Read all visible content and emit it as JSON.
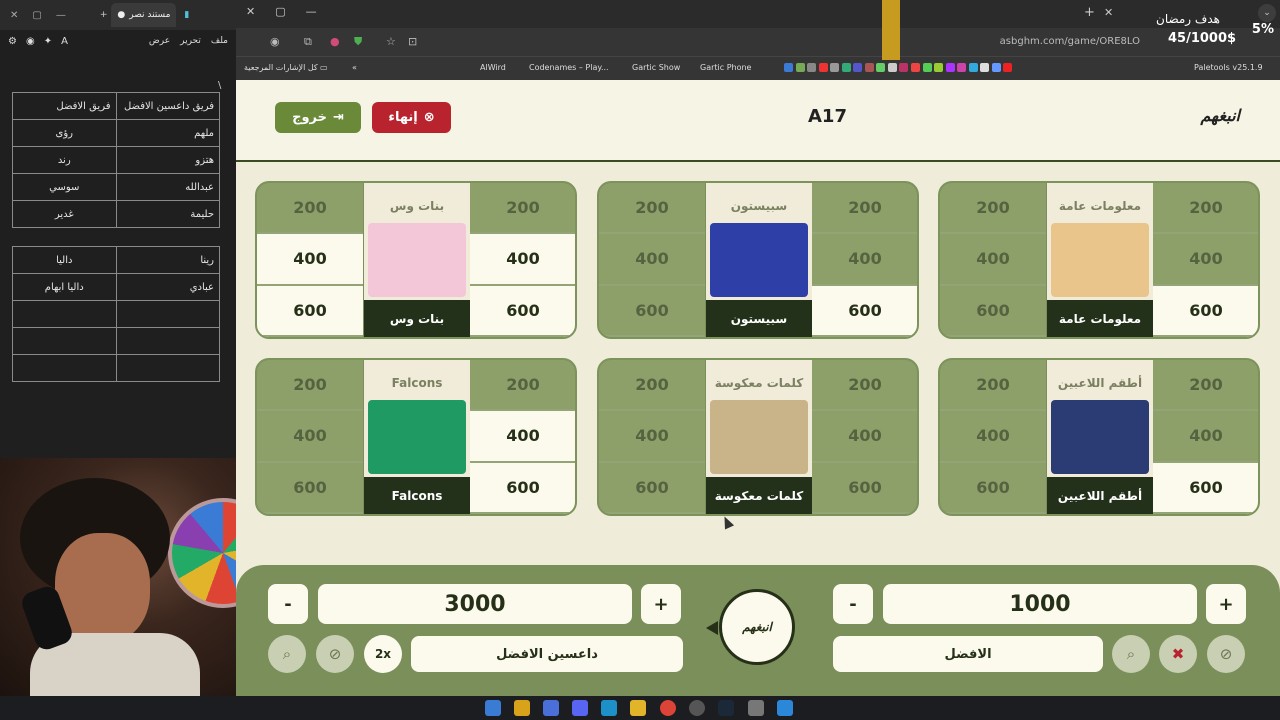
{
  "editor": {
    "tab_title": "مستند نصر",
    "menu": [
      "ملف",
      "تحرير",
      "عرض"
    ],
    "slash": "\\",
    "table1": {
      "headers": [
        "فريق داعسين الافضل",
        "فريق الافضل"
      ],
      "rows": [
        [
          "ملهم",
          "رؤى"
        ],
        [
          "هتزو",
          "رند"
        ],
        [
          "عبدالله",
          "سوسي"
        ],
        [
          "حليمة",
          "غدير"
        ]
      ]
    },
    "table2": {
      "rows": [
        [
          "رينا",
          "داليا"
        ],
        [
          "عبادي",
          "داليا ابهام"
        ],
        [
          "",
          ""
        ],
        [
          "",
          ""
        ],
        [
          "",
          ""
        ]
      ]
    }
  },
  "browser": {
    "url": "asbghm.com/game/ORE8LO",
    "bookmarks_folder": "كل الإشارات المرجعية",
    "bookmarks": [
      "AlWird",
      "Codenames – Play...",
      "Gartic Show",
      "Gartic Phone",
      "Paletools v25.1.9"
    ]
  },
  "overlay": {
    "goal_label": "هدف رمضان",
    "goal_value": "45/1000$",
    "percent": "5%"
  },
  "game": {
    "logo": "انبغهم",
    "room_code": "A17",
    "end_label": "إنهاء",
    "exit_label": "خروج",
    "categories": [
      {
        "name": "معلومات عامة",
        "left": [
          "200",
          "400",
          "600"
        ],
        "right": [
          "200",
          "400",
          "600"
        ],
        "art_color": "#e9c58c"
      },
      {
        "name": "سبيستون",
        "left": [
          "200",
          "400",
          "600"
        ],
        "right": [
          "200",
          "400",
          "600"
        ],
        "art_color": "#2f3fa8"
      },
      {
        "name": "بنات وس",
        "left": [
          "200",
          "400",
          "600"
        ],
        "right": [
          "200",
          "400",
          "600"
        ],
        "art_color": "#f3c7d8"
      },
      {
        "name": "أطقم اللاعبين",
        "left": [
          "200",
          "400",
          "600"
        ],
        "right": [
          "200",
          "400",
          "600"
        ],
        "art_color": "#2a3c73"
      },
      {
        "name": "كلمات معكوسة",
        "left": [
          "200",
          "400",
          "600"
        ],
        "right": [
          "200",
          "400",
          "600"
        ],
        "art_color": "#c9b48a"
      },
      {
        "name": "Falcons",
        "left": [
          "200",
          "400",
          "600"
        ],
        "right": [
          "200",
          "400",
          "600"
        ],
        "art_color": "#1f9a63"
      }
    ],
    "team_left": {
      "name": "داعسين الافضل",
      "score": "3000",
      "multiplier": "2x"
    },
    "team_right": {
      "name": "الافضل",
      "score": "1000"
    },
    "minus": "-",
    "plus": "+",
    "center_logo": "انبغهم"
  }
}
